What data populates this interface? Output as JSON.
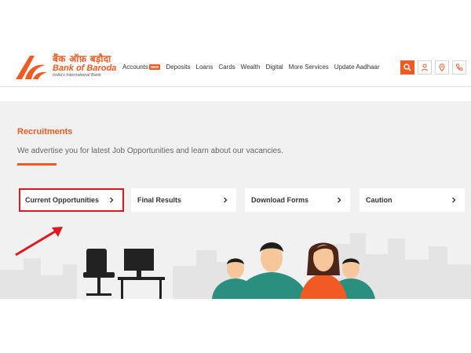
{
  "brand": {
    "hindi": "बैंक ऑफ़ बड़ौदा",
    "name": "Bank of Baroda",
    "tagline": "India's International Bank"
  },
  "nav": {
    "items": [
      {
        "label": "Accounts",
        "badge": "NEW"
      },
      {
        "label": "Deposits"
      },
      {
        "label": "Loans"
      },
      {
        "label": "Cards"
      },
      {
        "label": "Wealth"
      },
      {
        "label": "Digital"
      },
      {
        "label": "More Services"
      },
      {
        "label": "Update Aadhaar"
      }
    ]
  },
  "header_icons": [
    "search-icon",
    "user-icon",
    "location-icon",
    "phone-icon"
  ],
  "page": {
    "title": "Recruitments",
    "subtitle": "We advertise you for latest Job Opportunities and learn about our vacancies."
  },
  "cards": [
    {
      "label": "Current Opportunities",
      "highlighted": true
    },
    {
      "label": "Final Results"
    },
    {
      "label": "Download Forms"
    },
    {
      "label": "Caution"
    }
  ],
  "colors": {
    "brand": "#f15a22",
    "highlight_border": "#e0171f",
    "annotation_arrow": "#e0171f",
    "panel_bg": "#f1f1f1"
  }
}
